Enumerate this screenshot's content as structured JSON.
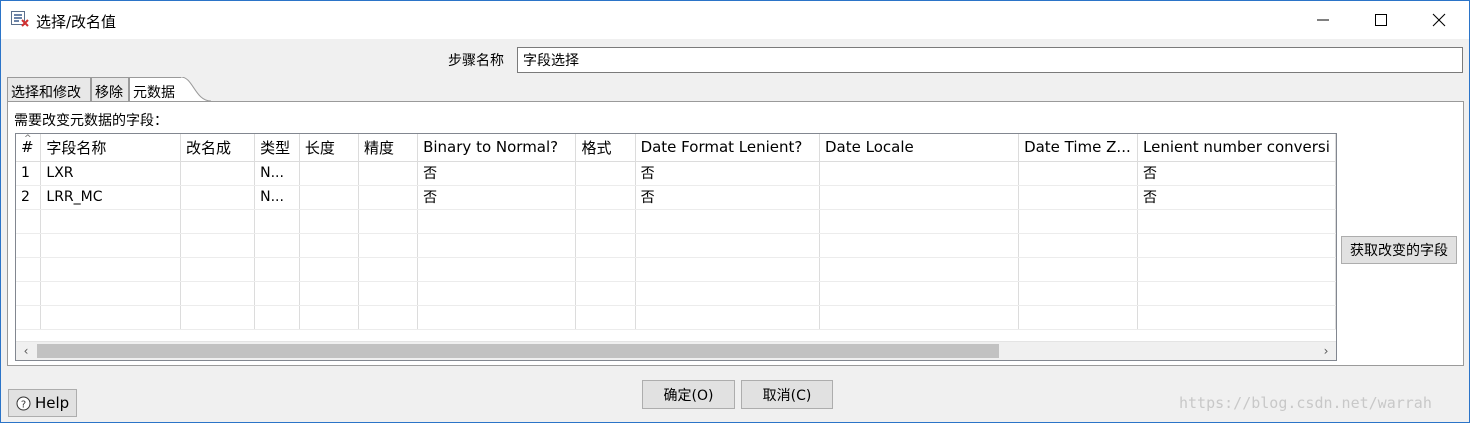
{
  "window": {
    "title": "选择/改名值",
    "icon": "select-rename-app-icon",
    "controls": [
      "minimize-icon",
      "maximize-icon",
      "close-icon"
    ]
  },
  "step": {
    "label": "步骤名称",
    "value": "字段选择"
  },
  "tabs": [
    {
      "label": "选择和修改",
      "active": false
    },
    {
      "label": "移除",
      "active": false
    },
    {
      "label": "元数据",
      "active": true
    }
  ],
  "panel": {
    "label": "需要改变元数据的字段："
  },
  "grid": {
    "sort_glyph": "^",
    "columns": [
      "#",
      "字段名称",
      "改名成",
      "类型",
      "长度",
      "精度",
      "Binary to Normal?",
      "格式",
      "Date Format Lenient?",
      "Date Locale",
      "Date Time Z...",
      "Lenient number conversi"
    ],
    "rows": [
      [
        "1",
        "LXR",
        "",
        "N...",
        "",
        "",
        "否",
        "",
        "否",
        "",
        "",
        "否"
      ],
      [
        "2",
        "LRR_MC",
        "",
        "N...",
        "",
        "",
        "否",
        "",
        "否",
        "",
        "",
        "否"
      ]
    ],
    "empty_rows": 5
  },
  "buttons": {
    "get_fields": "获取改变的字段",
    "ok": "确定(O)",
    "cancel": "取消(C)",
    "help": "Help"
  },
  "watermark": "https://blog.csdn.net/warrah"
}
